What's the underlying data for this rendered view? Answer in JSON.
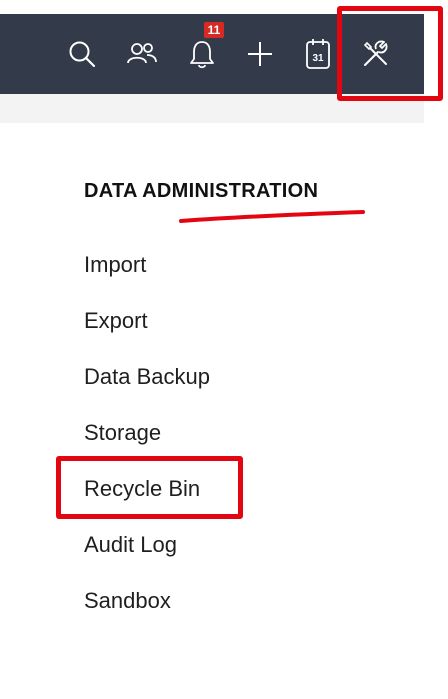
{
  "header": {
    "icons": [
      {
        "name": "search-icon"
      },
      {
        "name": "contacts-icon"
      },
      {
        "name": "bell-icon"
      },
      {
        "name": "plus-icon"
      },
      {
        "name": "calendar-icon"
      },
      {
        "name": "tools-icon"
      }
    ],
    "notification_count": "11",
    "calendar_day": "31"
  },
  "section": {
    "title": "DATA ADMINISTRATION",
    "items": [
      {
        "label": "Import"
      },
      {
        "label": "Export"
      },
      {
        "label": "Data Backup"
      },
      {
        "label": "Storage"
      },
      {
        "label": "Recycle Bin"
      },
      {
        "label": "Audit Log"
      },
      {
        "label": "Sandbox"
      }
    ]
  },
  "colors": {
    "topbar": "#333a4a",
    "annotation": "#e30611",
    "badge": "#d82a25"
  }
}
